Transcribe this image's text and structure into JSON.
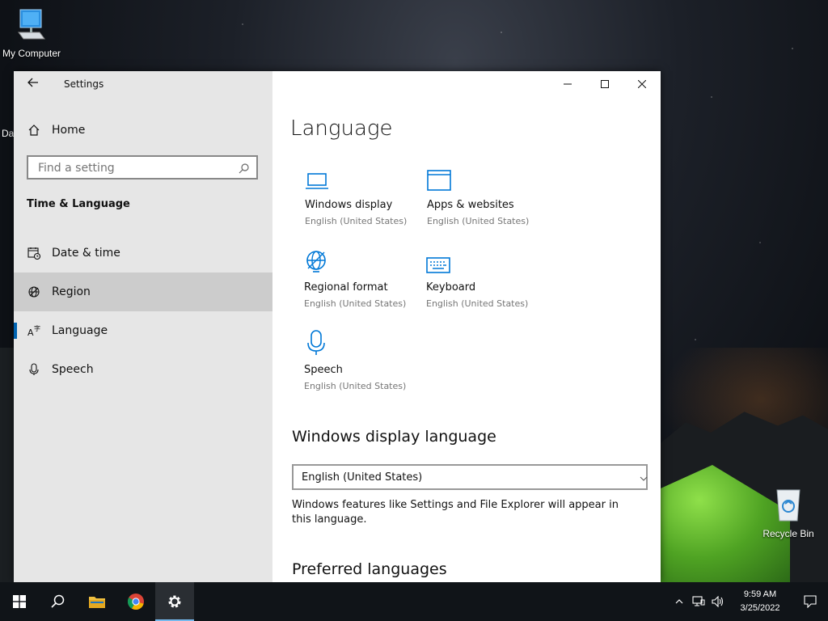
{
  "desktop": {
    "my_computer_label": "My Computer",
    "recycle_bin_label": "Recycle Bin",
    "partial_label": "Da"
  },
  "window": {
    "app_title": "Settings"
  },
  "sidebar": {
    "home_label": "Home",
    "search_placeholder": "Find a setting",
    "section_title": "Time & Language",
    "items": [
      {
        "label": "Date & time",
        "icon": "calendar-clock-icon"
      },
      {
        "label": "Region",
        "icon": "globe-icon"
      },
      {
        "label": "Language",
        "icon": "language-icon"
      },
      {
        "label": "Speech",
        "icon": "microphone-icon"
      }
    ]
  },
  "main": {
    "title": "Language",
    "tiles": [
      {
        "label": "Windows display",
        "sub": "English (United States)",
        "icon": "laptop-icon"
      },
      {
        "label": "Apps & websites",
        "sub": "English (United States)",
        "icon": "window-icon"
      },
      {
        "label": "Regional format",
        "sub": "English (United States)",
        "icon": "globe-icon"
      },
      {
        "label": "Keyboard",
        "sub": "English (United States)",
        "icon": "keyboard-icon"
      },
      {
        "label": "Speech",
        "sub": "English (United States)",
        "icon": "microphone-icon"
      }
    ],
    "display_language_heading": "Windows display language",
    "display_language_value": "English (United States)",
    "display_language_desc": "Windows features like Settings and File Explorer will appear in this language.",
    "preferred_heading": "Preferred languages"
  },
  "taskbar": {
    "time": "9:59 AM",
    "date": "3/25/2022"
  },
  "colors": {
    "accent": "#0063b1",
    "icon_blue": "#0078d7",
    "sidebar_bg": "#e6e6e6",
    "taskbar_bg": "#101418"
  }
}
